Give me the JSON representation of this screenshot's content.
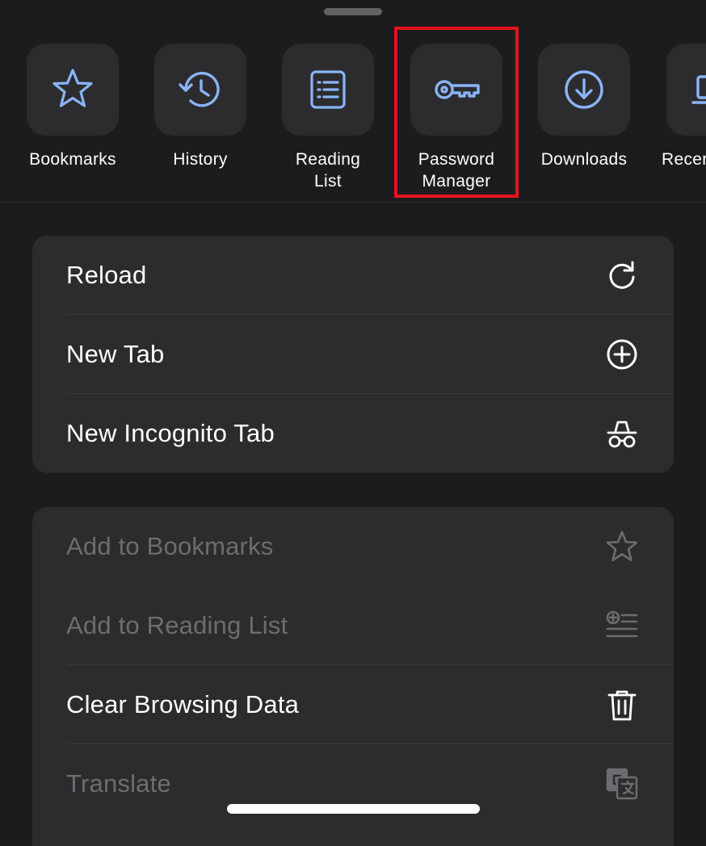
{
  "destinations": [
    {
      "label": "Bookmarks",
      "icon": "star-icon"
    },
    {
      "label": "History",
      "icon": "history-icon"
    },
    {
      "label": "Reading List",
      "icon": "reading-list-icon"
    },
    {
      "label": "Password\nManager",
      "icon": "key-icon"
    },
    {
      "label": "Downloads",
      "icon": "download-icon"
    },
    {
      "label": "Recer",
      "icon": "laptop-icon"
    }
  ],
  "menu_group_1": [
    {
      "label": "Reload",
      "icon": "reload-icon"
    },
    {
      "label": "New Tab",
      "icon": "add-circle-icon"
    },
    {
      "label": "New Incognito Tab",
      "icon": "incognito-icon"
    }
  ],
  "menu_group_2": [
    {
      "label": "Add to Bookmarks",
      "icon": "star-outline-icon",
      "enabled": false
    },
    {
      "label": "Add to Reading List",
      "icon": "add-list-icon",
      "enabled": false
    },
    {
      "label": "Clear Browsing Data",
      "icon": "trash-icon",
      "enabled": true
    },
    {
      "label": "Translate",
      "icon": "translate-icon",
      "enabled": false
    }
  ],
  "colors": {
    "accent": "#8ab4f8",
    "highlight": "#e4141b",
    "background": "#1c1c1e",
    "surface": "#2c2c2e"
  }
}
